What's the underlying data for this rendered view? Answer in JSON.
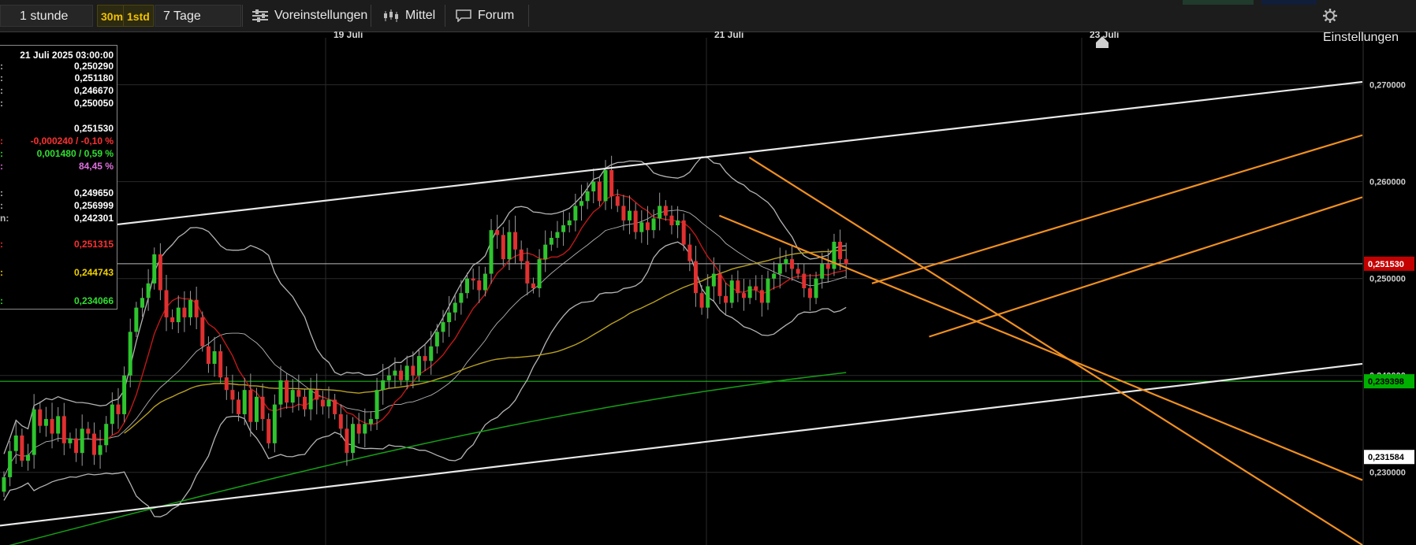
{
  "toolbar": {
    "period": "1 stunde",
    "interval_30m": "30m",
    "interval_1std": "1std",
    "range": "7 Tage",
    "presets": "Voreinstellungen",
    "indicators": "Mittel",
    "forum": "Forum",
    "settings": "Einstellungen"
  },
  "info_box": {
    "date": "21 Juli 2025 03:00:00",
    "rows": [
      {
        "label": ":",
        "value": "0,250290",
        "color": "#ffffff"
      },
      {
        "label": ":",
        "value": "0,251180",
        "color": "#ffffff"
      },
      {
        "label": ":",
        "value": "0,246670",
        "color": "#ffffff"
      },
      {
        "label": ":",
        "value": "0,250050",
        "color": "#ffffff"
      },
      {
        "label": "",
        "value": "0,251530",
        "color": "#ffffff"
      },
      {
        "label": ":",
        "value": "-0,000240 / -0,10 %",
        "color": "#ff3030"
      },
      {
        "label": ":",
        "value": "0,001480 / 0,59 %",
        "color": "#30e030"
      },
      {
        "label": ":",
        "value": "84,45 %",
        "color": "#e070e0"
      },
      {
        "label": ":",
        "value": "0,249650",
        "color": "#ffffff"
      },
      {
        "label": ":",
        "value": "0,256999",
        "color": "#ffffff"
      },
      {
        "label": "n:",
        "value": "0,242301",
        "color": "#ffffff"
      },
      {
        "label": ":",
        "value": "0,251315",
        "color": "#ff3030"
      },
      {
        "label": ":",
        "value": "0,244743",
        "color": "#f0d000"
      },
      {
        "label": ":",
        "value": "0,234066",
        "color": "#30e030"
      }
    ]
  },
  "chart_data": {
    "type": "candlestick",
    "x_labels": [
      "19 Juli",
      "21 Juli",
      "23 Juli"
    ],
    "ylim": [
      0.2225,
      0.2755
    ],
    "y_ticks": [
      {
        "value": 0.27,
        "label": "0,270000"
      },
      {
        "value": 0.26,
        "label": "0,260000"
      },
      {
        "value": 0.25,
        "label": "0,250000"
      },
      {
        "value": 0.24,
        "label": "0,240000"
      },
      {
        "value": 0.23,
        "label": "0,230000"
      }
    ],
    "price_badges": [
      {
        "value": 0.25153,
        "label": "0,251530",
        "bg": "#c40000",
        "fg": "#ffffff"
      },
      {
        "value": 0.239398,
        "label": "0,239398",
        "bg": "#00b000",
        "fg": "#000000"
      },
      {
        "value": 0.231584,
        "label": "0,231584",
        "bg": "#ffffff",
        "fg": "#000000"
      }
    ],
    "horizontal_lines": [
      {
        "value": 0.25153,
        "color": "#bbbbbb"
      },
      {
        "value": 0.239398,
        "color": "#22cc22"
      }
    ],
    "closes": [
      0.2295,
      0.2322,
      0.2338,
      0.2312,
      0.2318,
      0.2365,
      0.2348,
      0.2355,
      0.234,
      0.2358,
      0.233,
      0.2335,
      0.232,
      0.2345,
      0.234,
      0.2318,
      0.2328,
      0.235,
      0.237,
      0.236,
      0.24,
      0.2445,
      0.247,
      0.248,
      0.2495,
      0.2525,
      0.2488,
      0.246,
      0.2455,
      0.247,
      0.246,
      0.2478,
      0.246,
      0.243,
      0.2412,
      0.2425,
      0.2398,
      0.2385,
      0.2375,
      0.236,
      0.2385,
      0.2352,
      0.2378,
      0.2355,
      0.233,
      0.237,
      0.2395,
      0.2372,
      0.2385,
      0.2378,
      0.2365,
      0.2385,
      0.2375,
      0.2368,
      0.2375,
      0.236,
      0.2345,
      0.232,
      0.235,
      0.234,
      0.235,
      0.2355,
      0.2385,
      0.2395,
      0.24,
      0.2405,
      0.2395,
      0.241,
      0.24,
      0.242,
      0.2415,
      0.243,
      0.2445,
      0.2455,
      0.2465,
      0.2475,
      0.2485,
      0.25,
      0.2498,
      0.2488,
      0.2505,
      0.255,
      0.2545,
      0.252,
      0.2548,
      0.253,
      0.2518,
      0.2495,
      0.249,
      0.252,
      0.2535,
      0.2542,
      0.2548,
      0.2555,
      0.256,
      0.2575,
      0.258,
      0.259,
      0.26,
      0.258,
      0.2612,
      0.2585,
      0.2575,
      0.256,
      0.257,
      0.2548,
      0.2558,
      0.255,
      0.2562,
      0.2575,
      0.2565,
      0.2555,
      0.256,
      0.2535,
      0.2518,
      0.2485,
      0.247,
      0.2492,
      0.2505,
      0.2482,
      0.2475,
      0.2498,
      0.2485,
      0.248,
      0.2492,
      0.2488,
      0.2475,
      0.25,
      0.2505,
      0.2515,
      0.252,
      0.251,
      0.2505,
      0.249,
      0.248,
      0.25,
      0.2515,
      0.251,
      0.2538,
      0.252,
      0.2515
    ],
    "ma_red": {
      "color": "#c01818",
      "start_index": 15
    },
    "ma_yellow": {
      "color": "#b8a020",
      "start_index": 20
    },
    "ma_green": {
      "color": "#15a015",
      "start_value": 0.2222,
      "end_value": 0.2403
    },
    "bollinger": {
      "color": "#b4b4b4"
    },
    "trend_lines": [
      {
        "color": "#e8e8e8",
        "x1": 0,
        "y1": 0.2542,
        "x2": 1,
        "y2": 0.2703
      },
      {
        "color": "#e8e8e8",
        "x1": 0,
        "y1": 0.2245,
        "x2": 1,
        "y2": 0.2412
      },
      {
        "color": "#f09020",
        "x1": 0.55,
        "y1": 0.2625,
        "x2": 1,
        "y2": 0.2225
      },
      {
        "color": "#f09020",
        "x1": 0.528,
        "y1": 0.2565,
        "x2": 1,
        "y2": 0.2292
      },
      {
        "color": "#f09020",
        "x1": 0.64,
        "y1": 0.2495,
        "x2": 1,
        "y2": 0.2648
      },
      {
        "color": "#f09020",
        "x1": 0.682,
        "y1": 0.244,
        "x2": 1,
        "y2": 0.2584
      }
    ]
  }
}
